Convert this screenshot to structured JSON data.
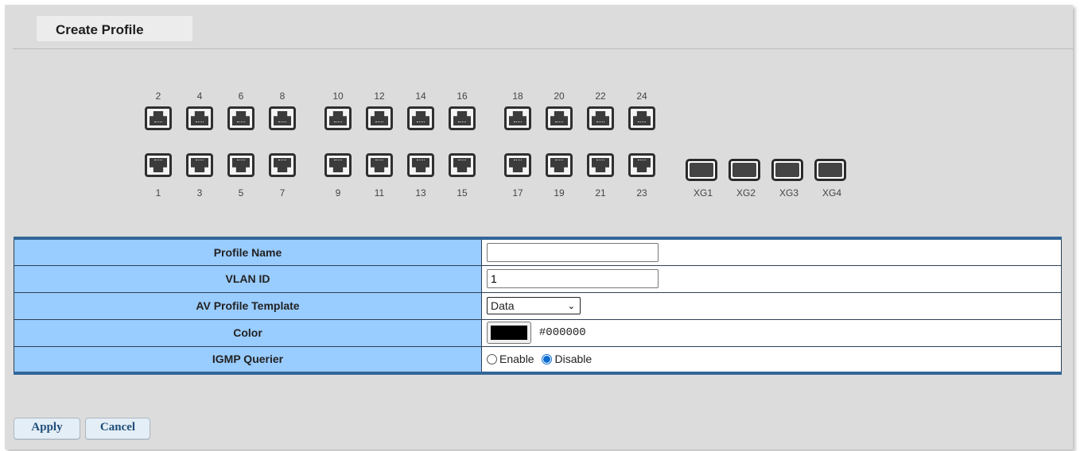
{
  "page": {
    "title": "Create Profile"
  },
  "ports": {
    "top_row": [
      "2",
      "4",
      "6",
      "8",
      "10",
      "12",
      "14",
      "16",
      "18",
      "20",
      "22",
      "24"
    ],
    "bottom_row": [
      "1",
      "3",
      "5",
      "7",
      "9",
      "11",
      "13",
      "15",
      "17",
      "19",
      "21",
      "23"
    ],
    "sfp": [
      "XG1",
      "XG2",
      "XG3",
      "XG4"
    ]
  },
  "form": {
    "profile_name": {
      "label": "Profile Name",
      "value": ""
    },
    "vlan_id": {
      "label": "VLAN ID",
      "value": "1"
    },
    "av_profile_template": {
      "label": "AV Profile Template",
      "selected": "Data"
    },
    "color": {
      "label": "Color",
      "value": "#000000"
    },
    "igmp_querier": {
      "label": "IGMP Querier",
      "options": [
        "Enable",
        "Disable"
      ],
      "selected": "Disable"
    }
  },
  "buttons": {
    "apply": "Apply",
    "cancel": "Cancel"
  },
  "theme": {
    "label_bg": "#99ccff",
    "border_accent": "#336699",
    "panel_bg": "#dcdcdc",
    "button_text": "#1f4e79"
  }
}
